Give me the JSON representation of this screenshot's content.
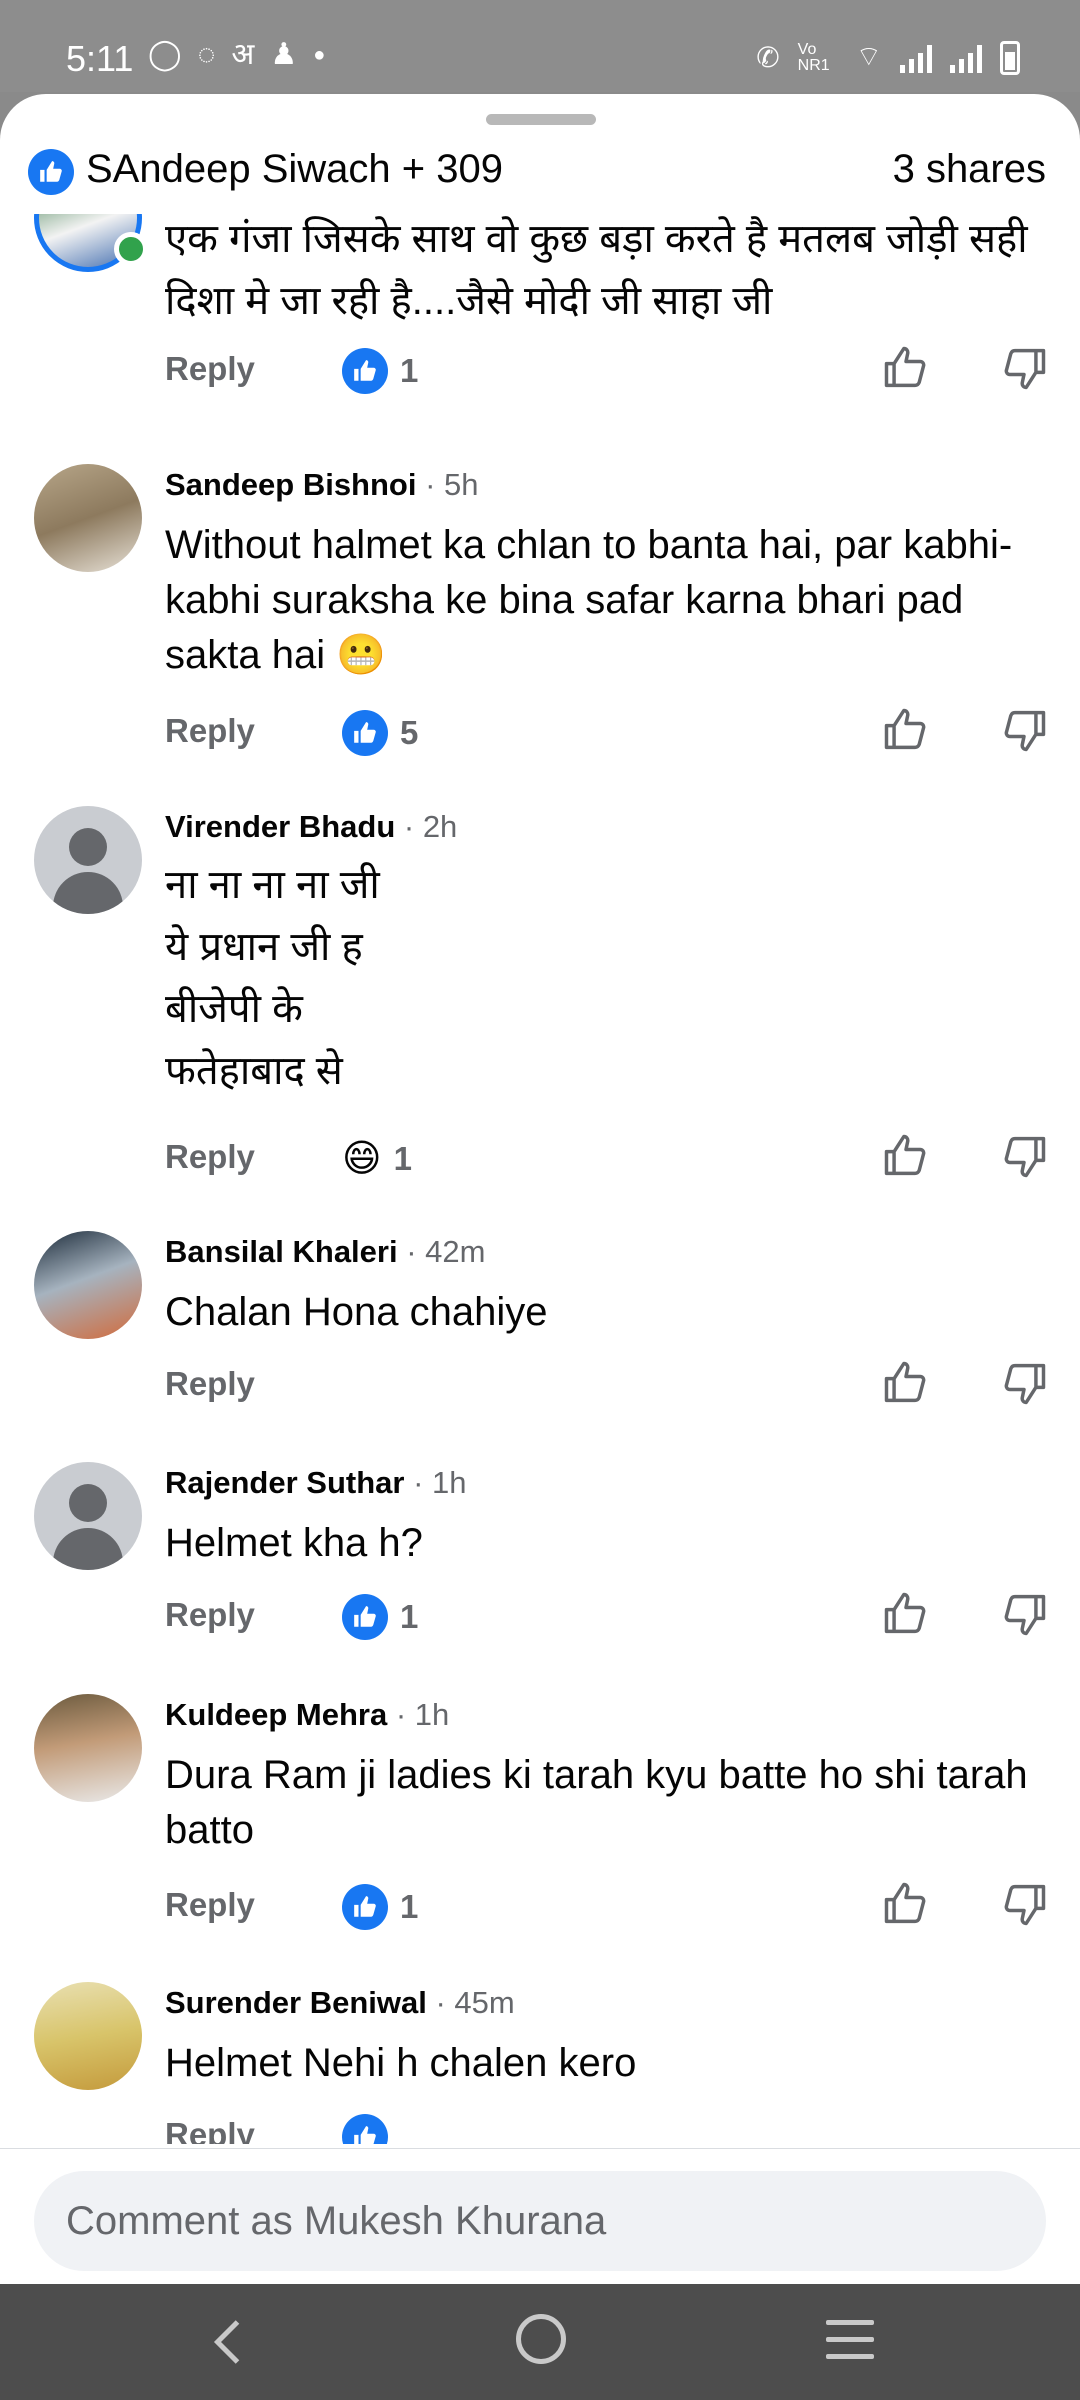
{
  "status_bar": {
    "time": "5:11",
    "left_icons": [
      "whatsapp-icon",
      "whatsapp-business-icon",
      "hindi-keyboard-icon",
      "news-app-icon",
      "dot-icon"
    ],
    "hindi_glyph": "अ",
    "right_icons": [
      "call-icon",
      "volte-icon",
      "wifi-icon",
      "signal-icon",
      "signal-icon",
      "battery-icon"
    ],
    "volte_label": "Vo NR1"
  },
  "header": {
    "reactors": "SAndeep Siwach + 309",
    "shares": "3 shares"
  },
  "comments": [
    {
      "name": "",
      "time": "",
      "text": "एक गंजा जिसके साथ वो कुछ बड़ा करते है मतलब जोड़ी सही दिशा मे जा रही है....जैसे मोदी जी साहा जी",
      "reply": "Reply",
      "reaction": "like",
      "count": "1"
    },
    {
      "name": "Sandeep Bishnoi",
      "time": " · 5h",
      "text": "Without halmet ka chlan to banta hai, par kabhi-kabhi suraksha ke bina safar karna bhari pad sakta hai 😬",
      "reply": "Reply",
      "reaction": "like",
      "count": "5"
    },
    {
      "name": "Virender Bhadu",
      "time": " · 2h",
      "lines": [
        "ना ना ना ना जी",
        "ये प्रधान जी ह",
        "बीजेपी के",
        "फतेहाबाद से"
      ],
      "reply": "Reply",
      "reaction": "haha",
      "emoji": "😄",
      "count": "1"
    },
    {
      "name": "Bansilal Khaleri",
      "time": " · 42m",
      "text": "Chalan Hona chahiye",
      "reply": "Reply",
      "reaction": "",
      "count": ""
    },
    {
      "name": "Rajender Suthar",
      "time": " · 1h",
      "text": "Helmet kha h?",
      "reply": "Reply",
      "reaction": "like",
      "count": "1"
    },
    {
      "name": "Kuldeep Mehra",
      "time": " · 1h",
      "text": "Dura Ram ji ladies ki tarah kyu batte ho shi tarah batto",
      "reply": "Reply",
      "reaction": "like",
      "count": "1"
    },
    {
      "name": "Surender Beniwal",
      "time": " · 45m",
      "text": "Helmet Nehi h chalen kero",
      "reply": "Reply",
      "reaction": "like",
      "count": ""
    }
  ],
  "composer": {
    "placeholder": "Comment as Mukesh Khurana"
  },
  "colors": {
    "accent": "#1877f2",
    "secondary_text": "#65676b",
    "online": "#31a24c"
  }
}
